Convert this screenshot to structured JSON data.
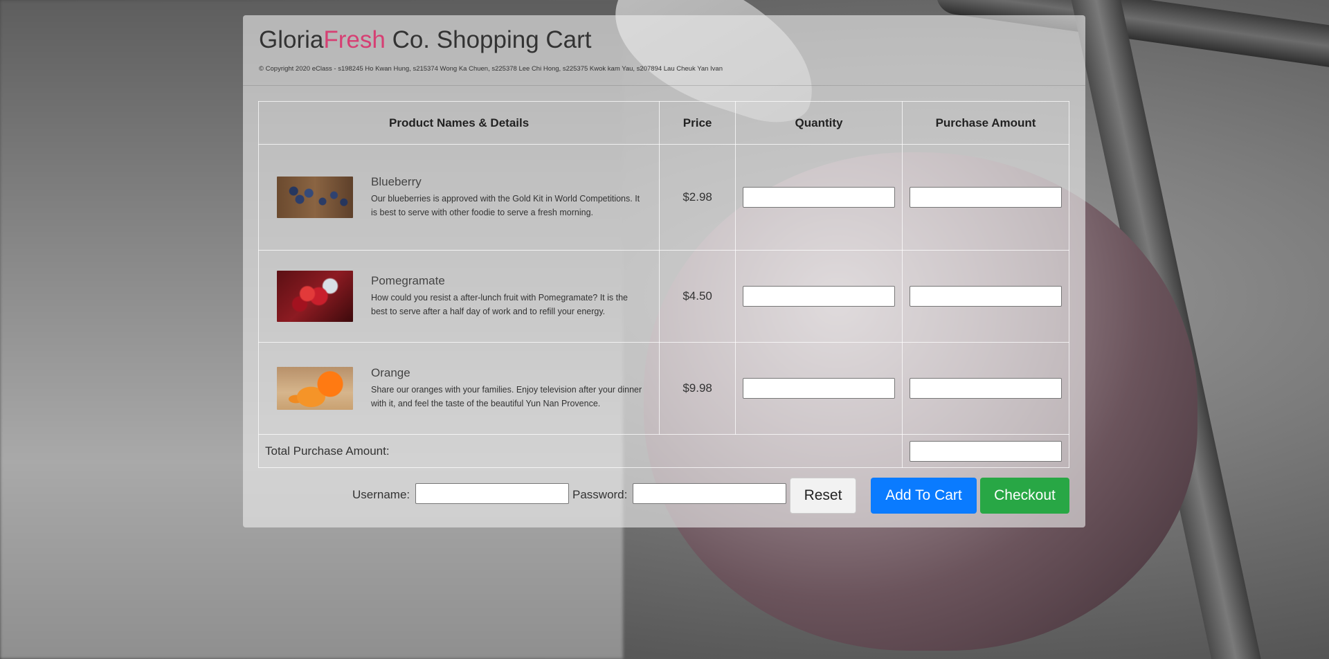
{
  "header": {
    "title_part1": "Gloria",
    "title_accent": "Fresh",
    "title_part2": " Co. Shopping Cart",
    "copyright": "© Copyright 2020 eClass - s198245 Ho Kwan Hung, s215374 Wong Ka Chuen, s225378 Lee Chi Hong, s225375 Kwok kam Yau, s207894 Lau Cheuk Yan Ivan"
  },
  "table": {
    "headers": [
      "Product Names & Details",
      "Price",
      "Quantity",
      "Purchase Amount"
    ],
    "products": [
      {
        "name": "Blueberry",
        "description": "Our blueberries is approved with the Gold Kit in World Competitions. It is best to serve with other foodie to serve a fresh morning.",
        "price": "$2.98",
        "quantity": "",
        "amount": ""
      },
      {
        "name": "Pomegramate",
        "description": "How could you resist a after-lunch fruit with Pomegramate? It is the best to serve after a half day of work and to refill your energy.",
        "price": "$4.50",
        "quantity": "",
        "amount": ""
      },
      {
        "name": "Orange",
        "description": "Share our oranges with your families. Enjoy television after your dinner with it, and feel the taste of the beautiful Yun Nan Provence.",
        "price": "$9.98",
        "quantity": "",
        "amount": ""
      }
    ],
    "total_label": "Total Purchase Amount:",
    "total_value": ""
  },
  "login": {
    "username_label": "Username:",
    "password_label": "Password:",
    "username_value": "",
    "password_value": ""
  },
  "buttons": {
    "reset": "Reset",
    "add_to_cart": "Add To Cart",
    "checkout": "Checkout"
  },
  "colors": {
    "accent": "#d63f73",
    "add_button": "#0a7bff",
    "checkout_button": "#28a745"
  }
}
